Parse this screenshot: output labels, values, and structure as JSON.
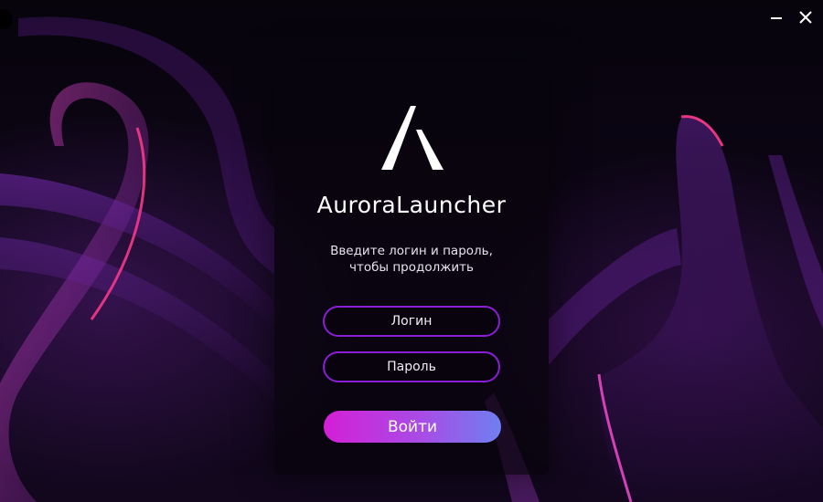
{
  "window": {
    "minimize_icon": "minimize-icon",
    "close_icon": "close-icon"
  },
  "brand": {
    "logo_icon": "aurora-logo-icon",
    "title": "AuroraLauncher"
  },
  "prompt": {
    "line1": "Введите логин и пароль,",
    "line2": "чтобы продолжить"
  },
  "form": {
    "login_placeholder": "Логин",
    "password_placeholder": "Пароль",
    "submit_label": "Войти"
  },
  "colors": {
    "accent_border": "#8a1ed6",
    "button_gradient_start": "#d41fd6",
    "button_gradient_end": "#6f7ff0",
    "text": "#ffffff"
  }
}
